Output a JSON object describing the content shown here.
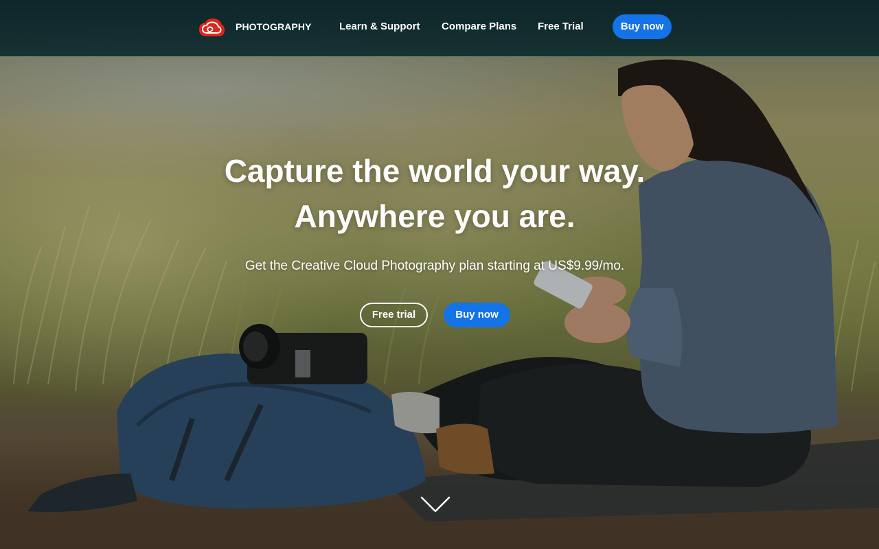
{
  "nav": {
    "brand": "PHOTOGRAPHY",
    "links": [
      "Learn & Support",
      "Compare Plans",
      "Free Trial"
    ],
    "buy_label": "Buy now",
    "icons": {
      "logo": "creative-cloud-logo"
    }
  },
  "hero": {
    "title_line1": "Capture the world your way.",
    "title_line2": "Anywhere you are.",
    "subtitle": "Get the Creative Cloud Photography plan starting at US$9.99/mo.",
    "free_trial_label": "Free trial",
    "buy_label": "Buy now",
    "scroll_icon": "chevron-down-icon"
  },
  "colors": {
    "nav_background": "#0e2c2e",
    "accent_blue": "#1473e6",
    "logo_red": "#e1251b",
    "text": "#ffffff"
  }
}
